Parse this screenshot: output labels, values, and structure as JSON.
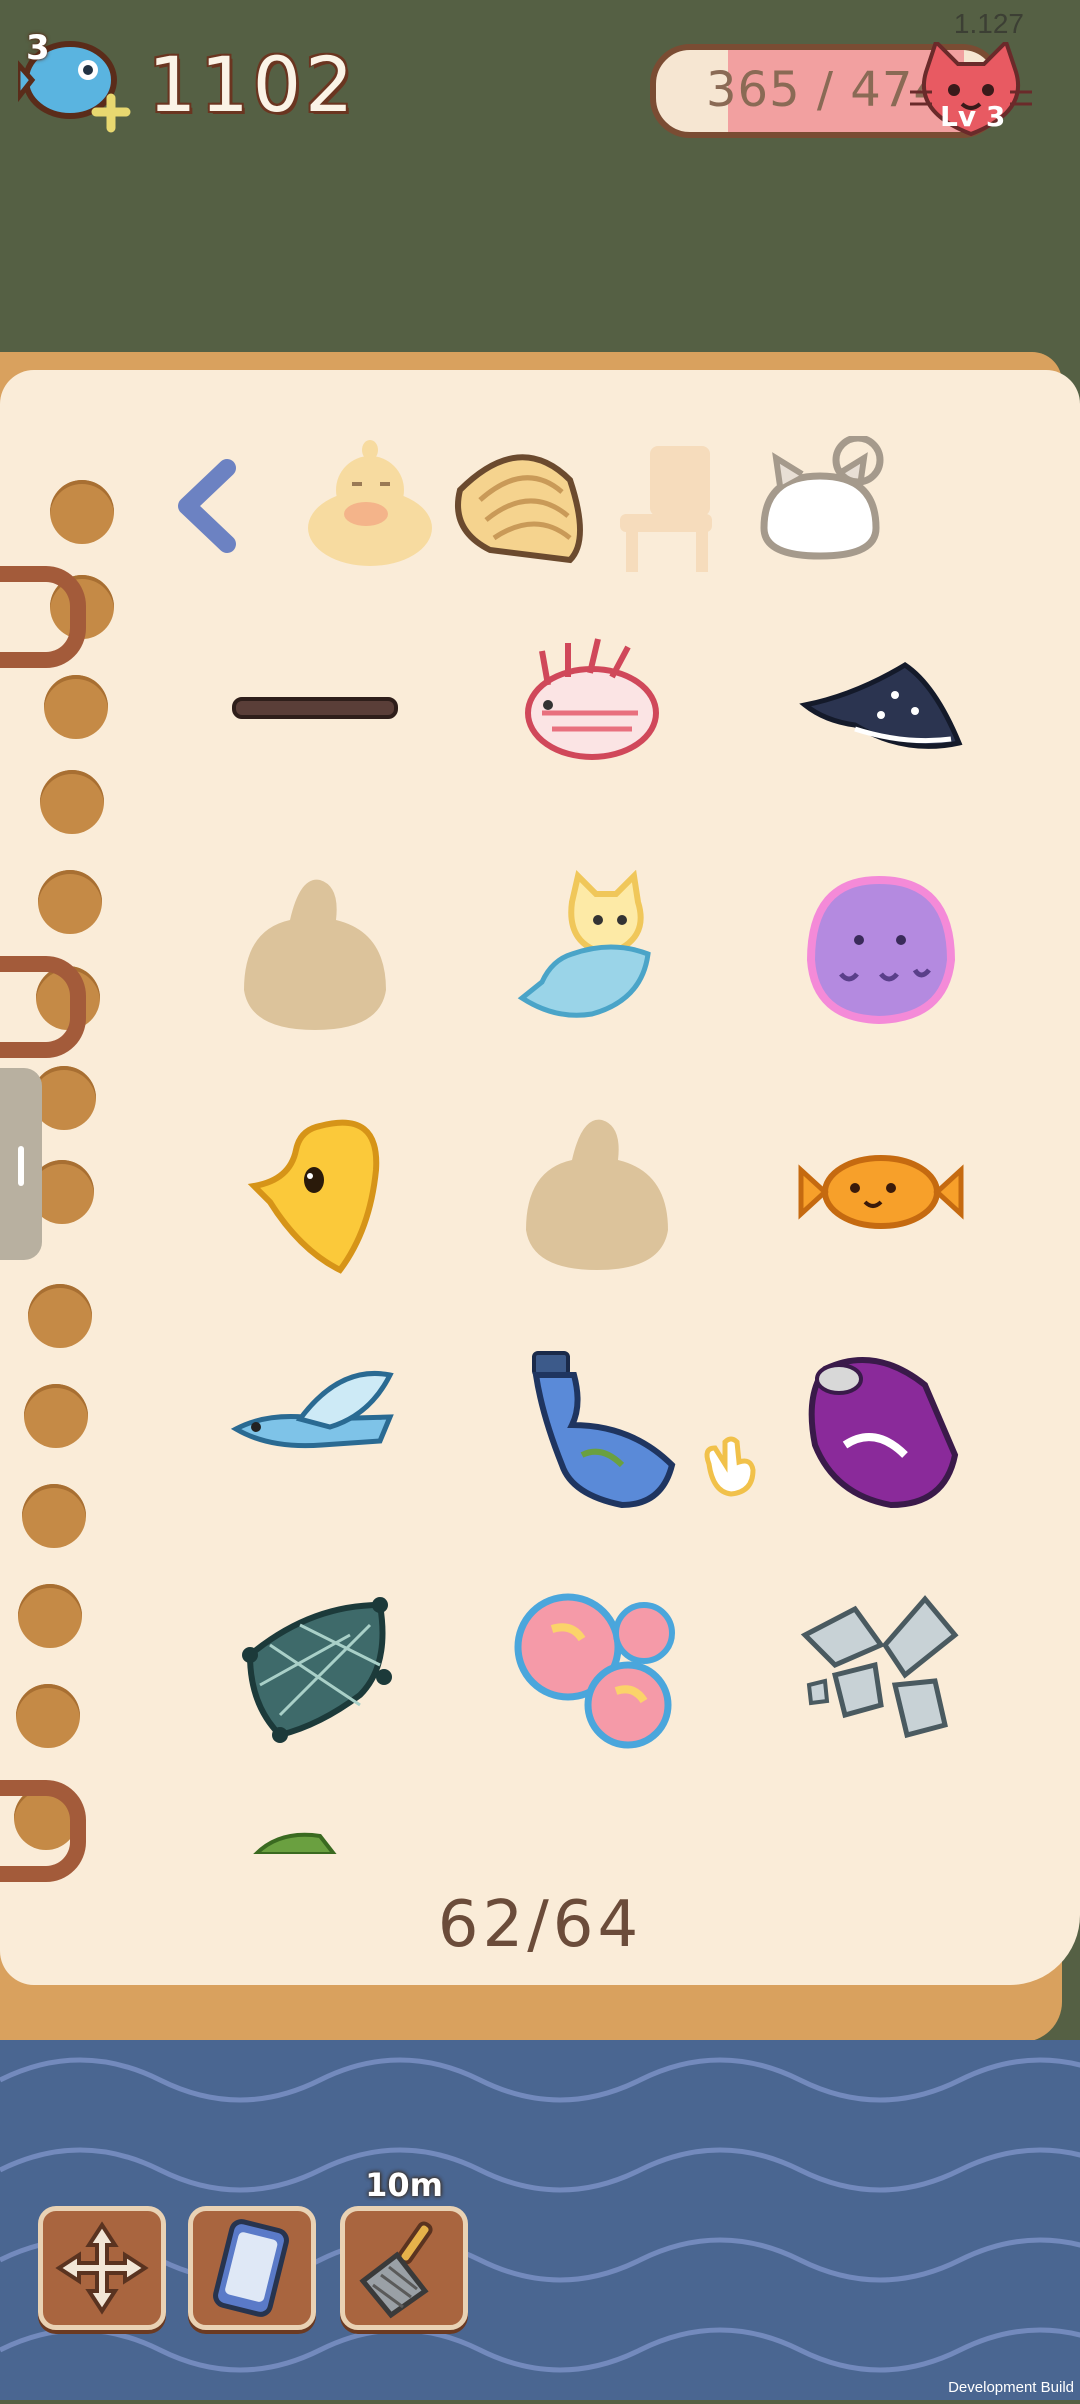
{
  "hud": {
    "version": "1.127",
    "fish_small_count": "3",
    "fish_total": "1102",
    "xp_text": "365 / 474",
    "xp_progress": 0.77,
    "level_label": "Lv 3"
  },
  "tabs": [
    {
      "icon": "back-arrow-icon"
    },
    {
      "icon": "duck-icon"
    },
    {
      "icon": "clam-shell-icon"
    },
    {
      "icon": "chair-icon"
    },
    {
      "icon": "cat-icon"
    }
  ],
  "items": [
    {
      "icon": "stick-icon"
    },
    {
      "icon": "lionfish-icon"
    },
    {
      "icon": "manta-ray-icon"
    },
    {
      "icon": "unknown-silhouette-icon"
    },
    {
      "icon": "cat-mermaid-icon"
    },
    {
      "icon": "jellyfish-icon"
    },
    {
      "icon": "yellow-fish-icon"
    },
    {
      "icon": "unknown-silhouette-icon"
    },
    {
      "icon": "candy-fish-icon"
    },
    {
      "icon": "flying-fish-icon"
    },
    {
      "icon": "plastic-bottle-icon"
    },
    {
      "icon": "soda-can-icon"
    },
    {
      "icon": "fishing-net-icon"
    },
    {
      "icon": "bubbles-icon"
    },
    {
      "icon": "glass-shards-icon"
    }
  ],
  "page_count": "62/64",
  "toolbar": {
    "timer": "10m",
    "buttons": [
      {
        "icon": "move-arrows-icon"
      },
      {
        "icon": "phone-icon"
      },
      {
        "icon": "net-scoop-icon"
      }
    ]
  },
  "dev_build": "Development Build",
  "colors": {
    "background": "#556044",
    "page": "#faecd8",
    "water": "#4a6691",
    "accent": "#f2a0a0"
  }
}
